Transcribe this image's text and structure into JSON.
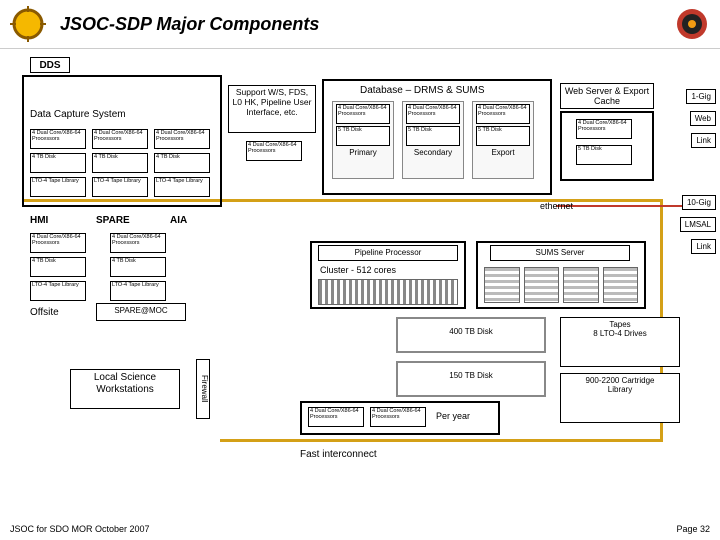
{
  "header": {
    "title": "JSOC-SDP  Major Components"
  },
  "dds": "DDS",
  "dcs": {
    "label": "Data Capture System",
    "box": {
      "line1": "4 Dual Core/X86-64",
      "line2": "Processors"
    },
    "disk": "4 TB Disk",
    "tape": "LTO-4 Tape Library"
  },
  "support": "Support W/S, FDS, L0 HK, Pipeline User Interface, etc.",
  "drms": {
    "title": "Database – DRMS & SUMS",
    "box": {
      "line1": "4 Dual Core/X86-64",
      "line2": "Processors"
    },
    "disk": "5 TB Disk",
    "cols": [
      "Primary",
      "Secondary",
      "Export"
    ]
  },
  "webserver": "Web Server & Export Cache",
  "webcache": {
    "box": {
      "line1": "4 Dual Core/X86-64",
      "line2": "Processors"
    },
    "disk": "5 TB Disk"
  },
  "right_tags": {
    "one_gig": "1-Gig",
    "web": "Web",
    "link": "Link",
    "ten_gig": "10-Gig",
    "lmsal": "LMSAL",
    "link2": "Link"
  },
  "ethernet": "ethernet",
  "hmi_row": {
    "hmi": "HMI",
    "spare": "SPARE",
    "aia": "AIA",
    "box": {
      "line1": "4 Dual Core/X86-64",
      "line2": "Processors"
    },
    "disk": "4 TB Disk",
    "tape": "LTO-4 Tape Library"
  },
  "offsite": "Offsite",
  "sparemoc": "SPARE@MOC",
  "pipeline": {
    "title": "Pipeline Processor",
    "sub": "Cluster - 512 cores"
  },
  "sums": {
    "title": "SUMS Server"
  },
  "disk400": "400 TB Disk",
  "disk150": "150 TB Disk",
  "tapes": {
    "title": "Tapes",
    "sub": "8 LTO-4 Drives"
  },
  "cartridge": {
    "title": "900-2200 Cartridge",
    "sub": "Library"
  },
  "peryear": {
    "label": "Per year",
    "box": {
      "line1": "4 Dual Core/X86-64",
      "line2": "Processors"
    }
  },
  "local_sci": "Local Science Workstations",
  "firewall": "Firewall",
  "fast": "Fast interconnect",
  "footer": {
    "left": "JSOC for SDO MOR October 2007",
    "right": "Page 32"
  }
}
